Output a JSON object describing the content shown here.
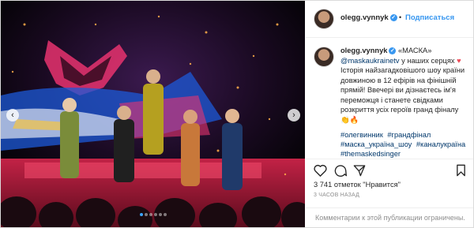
{
  "post": {
    "username": "olegg.vynnyk",
    "follow_label": "Подписаться",
    "separator": "•",
    "caption": {
      "username": "olegg.vynnyk",
      "mark": "«МАСКА»",
      "mention": "@maskaukrainetv",
      "text_1": " у наших серцях ",
      "heart": "♥",
      "text_2": "Історія найзагадковішого шоу країни довжиною в 12 ефірів на фінішній прямій! Ввечері ви дізнаєтесь ім'я переможця і станете свідками розкриття усіх героїв гранд фіналу ",
      "emoji": "👏🔥"
    },
    "hashtags": [
      "#олегвинник",
      "#грандфінал",
      "#маска_україна_шоу",
      "#каналукраїна",
      "#themaskedsinger"
    ],
    "likes": "3 741 отметок \"Нравится\"",
    "time": "3 ЧАСОВ НАЗАД",
    "comments_disabled": "Комментарии к этой публикации ограничены."
  },
  "carousel": {
    "slides": 6,
    "active": 1
  },
  "colors": {
    "accent": "#3897f0",
    "link": "#00376b",
    "stage_pink": "#e8336f"
  }
}
